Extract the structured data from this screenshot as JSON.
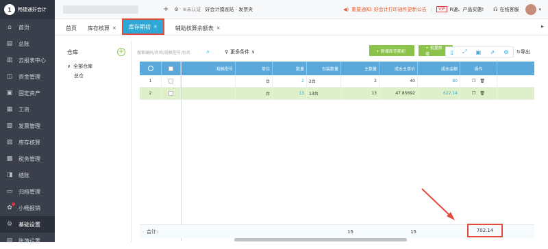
{
  "app": {
    "logo_badge": "1",
    "name": "畅捷通好会计"
  },
  "topbar": {
    "plus": "+",
    "gear": "⚙",
    "certified": "⊕未认证",
    "promo": "好会计摸底贴 · 发票夹",
    "notice_text": "重要通知: 好会计打印插件更新公告",
    "vip_badge": "VIP",
    "vip_text": "R速、产品实惠!",
    "service": "在线客服"
  },
  "sidebar": {
    "items": [
      {
        "label": "首页",
        "icon": "home-icon",
        "glyph": "⌂"
      },
      {
        "label": "总账",
        "icon": "ledger-icon",
        "glyph": "▤"
      },
      {
        "label": "云报表中心",
        "icon": "report-icon",
        "glyph": "▥"
      },
      {
        "label": "资金管理",
        "icon": "money-icon",
        "glyph": "◫"
      },
      {
        "label": "固定资产",
        "icon": "asset-icon",
        "glyph": "▣"
      },
      {
        "label": "工资",
        "icon": "salary-icon",
        "glyph": "▦"
      },
      {
        "label": "发票管理",
        "icon": "invoice-icon",
        "glyph": "▧"
      },
      {
        "label": "库存核算",
        "icon": "inventory-icon",
        "glyph": "▨"
      },
      {
        "label": "税务管理",
        "icon": "tax-icon",
        "glyph": "▩"
      },
      {
        "label": "结账",
        "icon": "close-account-icon",
        "glyph": "◨"
      },
      {
        "label": "归档管理",
        "icon": "archive-icon",
        "glyph": "▭"
      },
      {
        "label": "小畅报销",
        "icon": "reimburse-icon",
        "glyph": "✿"
      },
      {
        "label": "基础设置",
        "icon": "settings-icon",
        "glyph": "⚙"
      },
      {
        "label": "账簿设置",
        "icon": "books-icon",
        "glyph": "▤"
      }
    ]
  },
  "tabs": [
    {
      "label": "首页",
      "close": ""
    },
    {
      "label": "库存核算",
      "close": "×"
    },
    {
      "label": "库存期初",
      "close": "×"
    },
    {
      "label": "辅助核算余额表",
      "close": "×"
    }
  ],
  "left_panel": {
    "title": "仓库",
    "add": "+",
    "root": "全部仓库",
    "root_toggle": "∨",
    "child": "总仓"
  },
  "toolbar": {
    "search_placeholder": "搜索编码/名称/规格型号/别名",
    "more": "更多条件",
    "add_btn": "+ 新增库存期初",
    "batch_btn": "+ 批量新增",
    "export": "导出"
  },
  "grid": {
    "headers": [
      "⚙",
      "",
      "规格型号",
      "单位",
      "数量",
      "包装数量",
      "主数量",
      "成本主单价",
      "成本金额",
      "操作"
    ],
    "rows": [
      {
        "idx": "1",
        "spec": "",
        "unit": "台",
        "qty": "2",
        "pack": "2台",
        "main_qty": "2",
        "unit_cost": "40",
        "amount": "80"
      },
      {
        "idx": "2",
        "spec": "",
        "unit": "台",
        "qty": "13",
        "pack": "13台",
        "main_qty": "13",
        "unit_cost": "47.85692",
        "amount": "622.14"
      }
    ],
    "footer": {
      "label": "合计:",
      "qty": "15",
      "main_qty": "15",
      "amount": "702.14"
    }
  },
  "colors": {
    "sidebar": "#3a3f4b",
    "accent": "#2fa8d6",
    "green": "#8bc34a",
    "highlight": "#e24a3a"
  }
}
